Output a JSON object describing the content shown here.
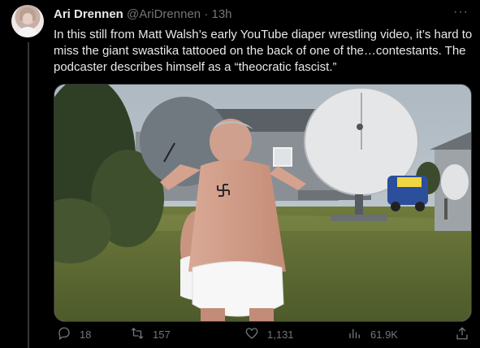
{
  "tweet": {
    "author_name": "Ari Drennen",
    "author_handle": "@AriDrennen",
    "separator": "·",
    "time": "13h",
    "more_glyph": "···",
    "text": "In this still from Matt Walsh’s early YouTube diaper wrestling video, it’s hard to miss the giant swastika tattooed on the back of one of the…contestants. The podcaster describes himself as a “theocratic fascist.”"
  },
  "actions": {
    "replies": "18",
    "retweets": "157",
    "likes": "1,131",
    "views": "61.9K"
  },
  "icons": {
    "reply": "reply-icon",
    "retweet": "retweet-icon",
    "like": "heart-icon",
    "views": "views-icon",
    "share": "share-icon"
  },
  "colors": {
    "background": "#000000",
    "text": "#e7e9ea",
    "secondary": "#71767b",
    "border": "#2f3336"
  }
}
